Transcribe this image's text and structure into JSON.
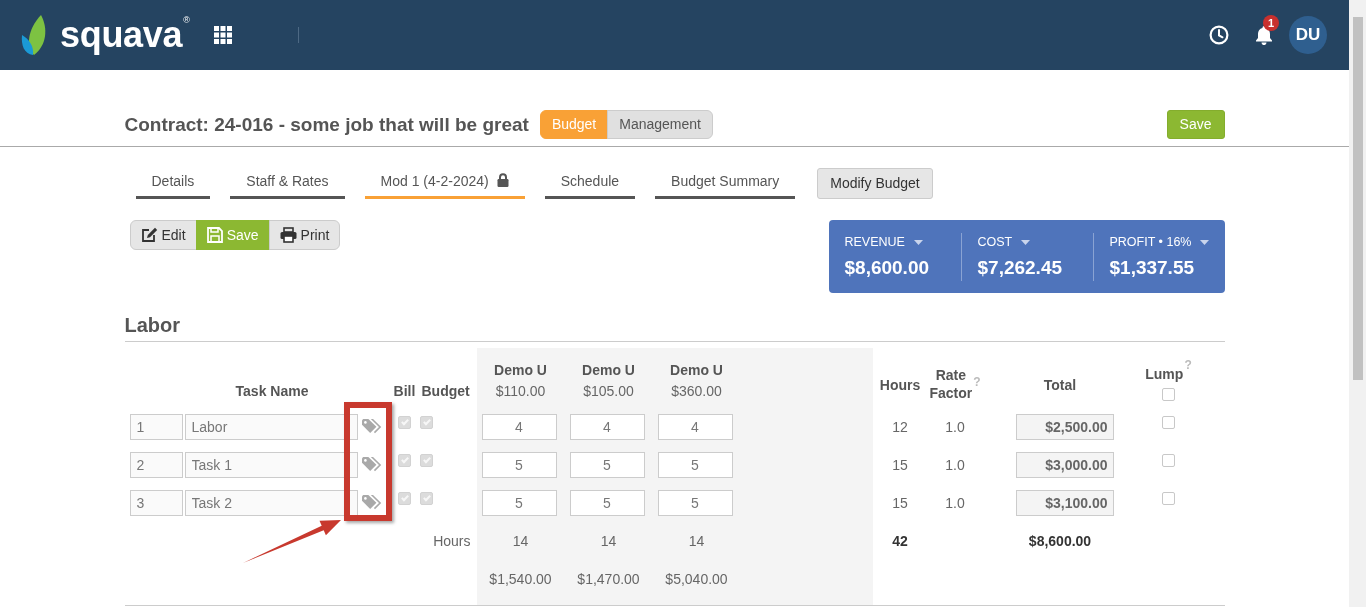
{
  "header": {
    "brand": "squava$^{®}$",
    "notification_count": "1",
    "avatar_initials": "DU"
  },
  "contract": {
    "title": "Contract: 24-016 - some job that will be great",
    "views": [
      {
        "label": "Budget",
        "selected": true
      },
      {
        "label": "Management",
        "selected": false
      }
    ],
    "save_label": "Save"
  },
  "tabs": [
    {
      "label": "Details",
      "selected": false,
      "locked": false
    },
    {
      "label": "Staff & Rates",
      "selected": false,
      "locked": false
    },
    {
      "label": "Mod 1 (4-2-2024)",
      "selected": true,
      "locked": true
    },
    {
      "label": "Schedule",
      "selected": false,
      "locked": false
    },
    {
      "label": "Budget Summary",
      "selected": false,
      "locked": false
    }
  ],
  "modify_label": "Modify Budget",
  "toolbar": [
    {
      "kind": "edit",
      "label": "Edit",
      "selected": false
    },
    {
      "kind": "save",
      "label": "Save",
      "selected": true
    },
    {
      "kind": "print",
      "label": "Print",
      "selected": false
    }
  ],
  "summary": [
    {
      "label": "REVENUE",
      "value": "$8,600.00"
    },
    {
      "label": "COST",
      "value": "$7,262.45"
    },
    {
      "label": "PROFIT • 16%",
      "value": "$1,337.55"
    }
  ],
  "labor": {
    "title": "Labor",
    "columns": {
      "task_name": "Task Name",
      "bill": "Bill",
      "budget": "Budget",
      "staff": [
        {
          "name": "Demo U",
          "rate": "$110.00"
        },
        {
          "name": "Demo U",
          "rate": "$105.00"
        },
        {
          "name": "Demo U",
          "rate": "$360.00"
        }
      ],
      "hours": "Hours",
      "rate_factor": "Rate Factor",
      "rate_factor_help": "?",
      "total": "Total",
      "lump": "Lump",
      "lump_help": "?",
      "lump_all": false
    },
    "rows": [
      {
        "number": "1",
        "task": "Labor",
        "bill": true,
        "budget": true,
        "staff_hours": [
          "4",
          "4",
          "4"
        ],
        "hours": "12",
        "rate_factor": "1.0",
        "total": "$2,500.00",
        "lump": false
      },
      {
        "number": "2",
        "task": "Task 1",
        "bill": true,
        "budget": true,
        "staff_hours": [
          "5",
          "5",
          "5"
        ],
        "hours": "15",
        "rate_factor": "1.0",
        "total": "$3,000.00",
        "lump": false
      },
      {
        "number": "3",
        "task": "Task 2",
        "bill": true,
        "budget": true,
        "staff_hours": [
          "5",
          "5",
          "5"
        ],
        "hours": "15",
        "rate_factor": "1.0",
        "total": "$3,100.00",
        "lump": false
      }
    ],
    "totals": {
      "label": "Hours",
      "staff_hours": [
        "14",
        "14",
        "14"
      ],
      "hours": "42",
      "total": "$8,600.00"
    },
    "staff_costs": [
      "$1,540.00",
      "$1,470.00",
      "$5,040.00"
    ]
  }
}
